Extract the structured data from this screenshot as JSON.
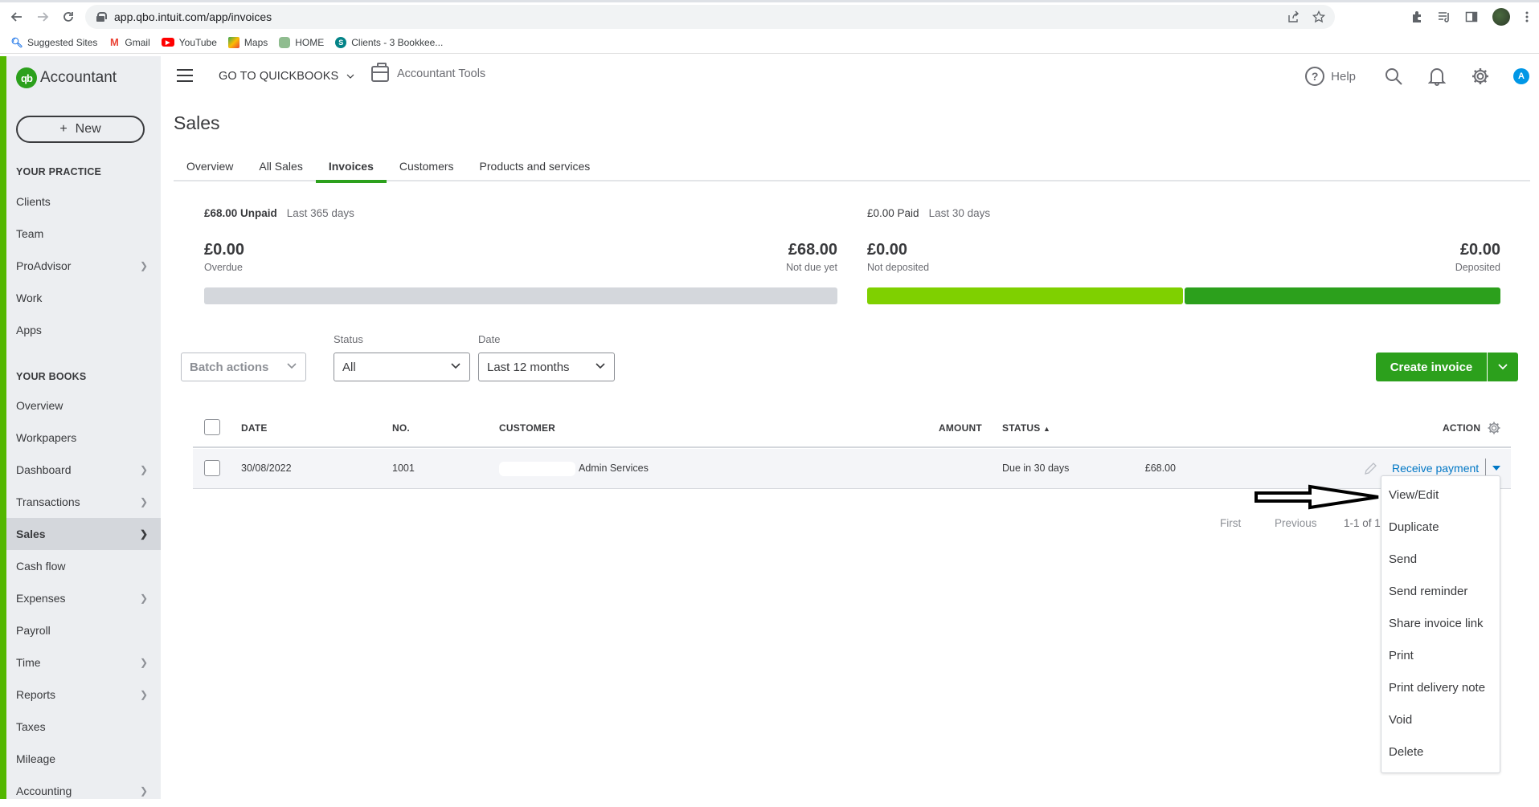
{
  "browser": {
    "url": "app.qbo.intuit.com/app/invoices",
    "bookmarks": [
      {
        "label": "Suggested Sites",
        "icon": "search-icon"
      },
      {
        "label": "Gmail",
        "icon": "gmail-icon"
      },
      {
        "label": "YouTube",
        "icon": "youtube-icon"
      },
      {
        "label": "Maps",
        "icon": "maps-icon"
      },
      {
        "label": "HOME",
        "icon": "database-icon"
      },
      {
        "label": "Clients - 3 Bookkee...",
        "icon": "sharepoint-icon"
      }
    ]
  },
  "app": {
    "logo_mark": "qb",
    "logo_text": "Accountant",
    "new_button": "New",
    "new_button_icon": "+",
    "header": {
      "goto_quickbooks": "GO TO QUICKBOOKS",
      "accountant_tools": "Accountant Tools",
      "help": "Help",
      "user_initial": "A"
    }
  },
  "sidebar": {
    "sections": [
      {
        "title": "YOUR PRACTICE",
        "items": [
          {
            "label": "Clients",
            "chevron": false
          },
          {
            "label": "Team",
            "chevron": false
          },
          {
            "label": "ProAdvisor",
            "chevron": true
          },
          {
            "label": "Work",
            "chevron": false
          },
          {
            "label": "Apps",
            "chevron": false
          }
        ]
      },
      {
        "title": "YOUR BOOKS",
        "items": [
          {
            "label": "Overview",
            "chevron": false
          },
          {
            "label": "Workpapers",
            "chevron": false
          },
          {
            "label": "Dashboard",
            "chevron": true
          },
          {
            "label": "Transactions",
            "chevron": true
          },
          {
            "label": "Sales",
            "chevron": true,
            "active": true
          },
          {
            "label": "Cash flow",
            "chevron": false
          },
          {
            "label": "Expenses",
            "chevron": true
          },
          {
            "label": "Payroll",
            "chevron": false
          },
          {
            "label": "Time",
            "chevron": true
          },
          {
            "label": "Reports",
            "chevron": true
          },
          {
            "label": "Taxes",
            "chevron": false
          },
          {
            "label": "Mileage",
            "chevron": false
          },
          {
            "label": "Accounting",
            "chevron": true
          }
        ]
      }
    ]
  },
  "page": {
    "title": "Sales",
    "tabs": [
      {
        "label": "Overview"
      },
      {
        "label": "All Sales"
      },
      {
        "label": "Invoices",
        "active": true
      },
      {
        "label": "Customers"
      },
      {
        "label": "Products and services"
      }
    ],
    "unpaid": {
      "total": "£68.00 Unpaid",
      "range": "Last 365 days",
      "left_amount": "£0.00",
      "left_label": "Overdue",
      "right_amount": "£68.00",
      "right_label": "Not due yet",
      "overdue_fraction": 0,
      "bar_color": "#d4d7dc"
    },
    "paid": {
      "total": "£0.00 Paid",
      "range": "Last 30 days",
      "left_amount": "£0.00",
      "left_label": "Not deposited",
      "right_amount": "£0.00",
      "right_label": "Deposited",
      "not_deposited_fraction": 0.5,
      "left_color": "#7fd000",
      "right_color": "#2ca01c"
    },
    "filters": {
      "batch_actions": "Batch actions",
      "status_label": "Status",
      "status_value": "All",
      "date_label": "Date",
      "date_value": "Last 12 months"
    },
    "create_invoice": "Create invoice",
    "accent_color": "#2ca01c"
  },
  "table": {
    "columns": [
      "DATE",
      "NO.",
      "CUSTOMER",
      "AMOUNT",
      "STATUS",
      "ACTION"
    ],
    "status_sort": "▲",
    "rows": [
      {
        "date": "30/08/2022",
        "no": "1001",
        "customer": "Admin Services",
        "amount": "£68.00",
        "status": "Due in 30 days",
        "action": "Receive payment"
      }
    ],
    "pagination": {
      "first": "First",
      "previous": "Previous",
      "count": "1-1 of 1"
    }
  },
  "action_menu": {
    "items": [
      "View/Edit",
      "Duplicate",
      "Send",
      "Send reminder",
      "Share invoice link",
      "Print",
      "Print delivery note",
      "Void",
      "Delete"
    ]
  }
}
